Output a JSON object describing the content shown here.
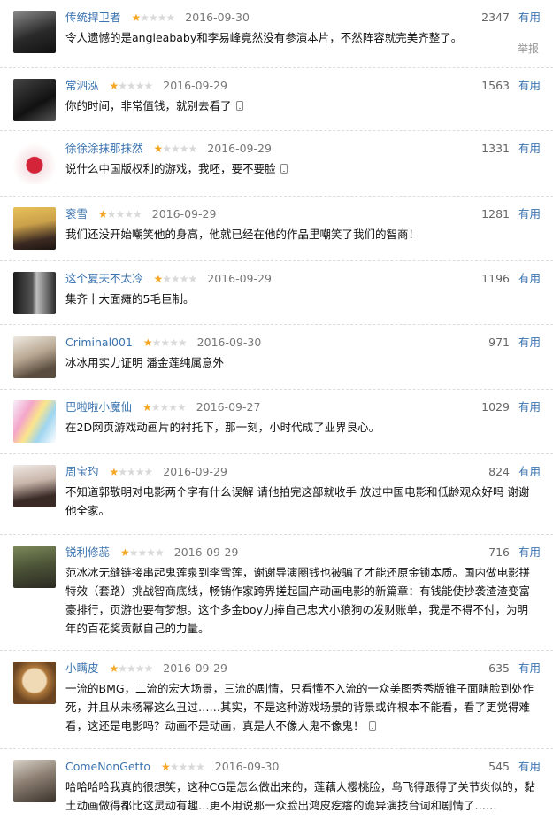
{
  "comments": [
    {
      "user": "传统捍卫者",
      "stars": 1,
      "date": "2016-09-30",
      "votes": "2347",
      "useful": "有用",
      "text": "令人遗憾的是angleababy和李易峰竟然没有参演本片，不然阵容就完美齐整了。",
      "mobile": false,
      "report": "举报"
    },
    {
      "user": "常泗泓",
      "stars": 1,
      "date": "2016-09-29",
      "votes": "1563",
      "useful": "有用",
      "text": "你的时间，非常值钱，就别去看了",
      "mobile": true
    },
    {
      "user": "徐徐涂抹那抹然",
      "stars": 1,
      "date": "2016-09-29",
      "votes": "1331",
      "useful": "有用",
      "text": "说什么中国版权利的游戏，我呸，要不要脸",
      "mobile": true
    },
    {
      "user": "衮雪",
      "stars": 1,
      "date": "2016-09-29",
      "votes": "1281",
      "useful": "有用",
      "text": "我们还没开始嘲笑他的身高，他就已经在他的作品里嘲笑了我们的智商！",
      "mobile": false
    },
    {
      "user": "这个夏天不太冷",
      "stars": 1,
      "date": "2016-09-29",
      "votes": "1196",
      "useful": "有用",
      "text": "集齐十大面瘫的5毛巨制。",
      "mobile": false
    },
    {
      "user": "Criminal001",
      "stars": 1,
      "date": "2016-09-30",
      "votes": "971",
      "useful": "有用",
      "text": "冰冰用实力证明 潘金莲纯属意外",
      "mobile": false
    },
    {
      "user": "巴啦啦小魔仙",
      "stars": 1,
      "date": "2016-09-27",
      "votes": "1029",
      "useful": "有用",
      "text": "在2D网页游戏动画片的衬托下，那一刻，小时代成了业界良心。",
      "mobile": false
    },
    {
      "user": "周宝玓",
      "stars": 1,
      "date": "2016-09-29",
      "votes": "824",
      "useful": "有用",
      "text": "不知道郭敬明对电影两个字有什么误解 请他拍完这部就收手 放过中国电影和低龄观众好吗 谢谢他全家。",
      "mobile": false
    },
    {
      "user": "锐利修蕊",
      "stars": 1,
      "date": "2016-09-29",
      "votes": "716",
      "useful": "有用",
      "text": "范冰冰无缝链接串起鬼莲泉到李雪莲，谢谢导演圈钱也被骗了才能还原金锁本质。国内做电影拼特效（套路）挑战智商底线，畅销作家跨界搓起国产动画电影的新篇章：有钱能使抄袭渣渣变富豪排行，页游也要有梦想。这个多金boy力捧自己忠犬小狼狗の发财账单，我是不得不付，为明年的百花奖贡献自己的力量。",
      "mobile": false
    },
    {
      "user": "小瞒皮",
      "stars": 1,
      "date": "2016-09-29",
      "votes": "635",
      "useful": "有用",
      "text": "一流的BMG，二流的宏大场景，三流的剧情，只看懂不入流的一众美图秀秀版锥子面瞎脸到处作死，并且从未杨幂这么丑过……其实，不是这种游戏场景的背景或许根本不能看，看了更觉得难看，这还是电影吗？动画不是动画，真是人不像人鬼不像鬼！",
      "mobile": true
    },
    {
      "user": "ComeNonGetto",
      "stars": 1,
      "date": "2016-09-30",
      "votes": "545",
      "useful": "有用",
      "text": "哈哈哈哈我真的很想笑，这种CG是怎么做出来的，莲藕人樱桃脸，鸟飞得跟得了关节炎似的，黏土动画做得都比这灵动有趣…更不用说那一众脸出鸿皮疙瘩的诡异演技台词和剧情了……",
      "mobile": false
    }
  ]
}
